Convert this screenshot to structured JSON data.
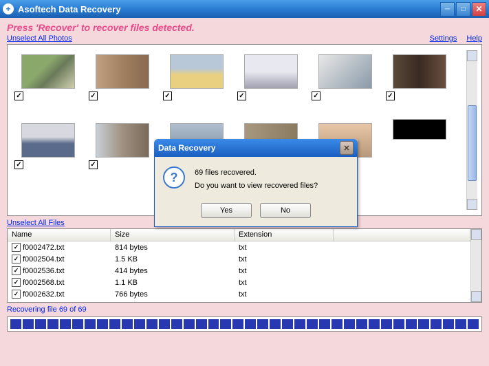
{
  "window": {
    "title": "Asoftech Data Recovery"
  },
  "header": {
    "press_line": "Press 'Recover' to recover files detected.",
    "unselect_photos": "Unselect All Photos",
    "settings": "Settings",
    "help": "Help"
  },
  "files": {
    "unselect_files": "Unselect All Files",
    "columns": {
      "name": "Name",
      "size": "Size",
      "ext": "Extension"
    },
    "rows": [
      {
        "name": "f0002472.txt",
        "size": "814 bytes",
        "ext": "txt"
      },
      {
        "name": "f0002504.txt",
        "size": "1.5 KB",
        "ext": "txt"
      },
      {
        "name": "f0002536.txt",
        "size": "414 bytes",
        "ext": "txt"
      },
      {
        "name": "f0002568.txt",
        "size": "1.1 KB",
        "ext": "txt"
      },
      {
        "name": "f0002632.txt",
        "size": "766 bytes",
        "ext": "txt"
      }
    ]
  },
  "progress": {
    "status": "Recovering file 69 of 69"
  },
  "dialog": {
    "title": "Data Recovery",
    "line1": "69 files recovered.",
    "line2": "Do you want to view recovered files?",
    "yes": "Yes",
    "no": "No"
  }
}
